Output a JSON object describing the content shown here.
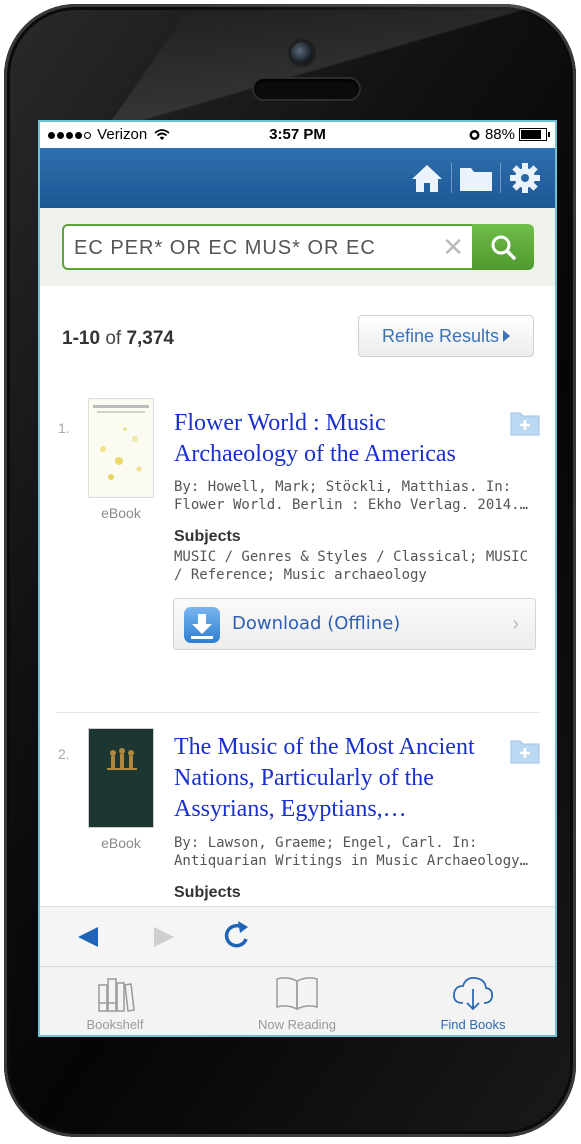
{
  "status": {
    "carrier": "Verizon",
    "time": "3:57 PM",
    "battery": "88%"
  },
  "search": {
    "query": "EC PER* OR EC MUS* OR EC",
    "clear": "✕"
  },
  "results_header": {
    "range": "1-10",
    "of": "of",
    "total": "7,374",
    "refine_label": "Refine Results"
  },
  "results": [
    {
      "index": "1.",
      "type": "eBook",
      "title": "Flower World : Music Archaeology of the Americas",
      "by": "By: Howell, Mark; Stöckli, Matthias. In:",
      "by2": "Flower World. Berlin : Ekho Verlag. 2014.…",
      "subjects_label": "Subjects",
      "subjects": "MUSIC / Genres & Styles / Classical; MUSIC / Reference; Music archaeology",
      "download_label": "Download (Offline)"
    },
    {
      "index": "2.",
      "type": "eBook",
      "title": "The Music of the Most Ancient Nations, Particularly of the Assyrians, Egyptians,…",
      "by": "By: Lawson, Graeme; Engel, Carl. In:",
      "by2": "Antiquarian Writings in Music Archaeology…",
      "subjects_label": "Subjects"
    }
  ],
  "tabs": [
    {
      "label": "Bookshelf"
    },
    {
      "label": "Now Reading"
    },
    {
      "label": "Find Books"
    }
  ],
  "colors": {
    "appbar": "#1d5796",
    "search_green": "#5aa43a",
    "link_blue": "#1a2fcf",
    "active_tab": "#2d6ab3"
  }
}
